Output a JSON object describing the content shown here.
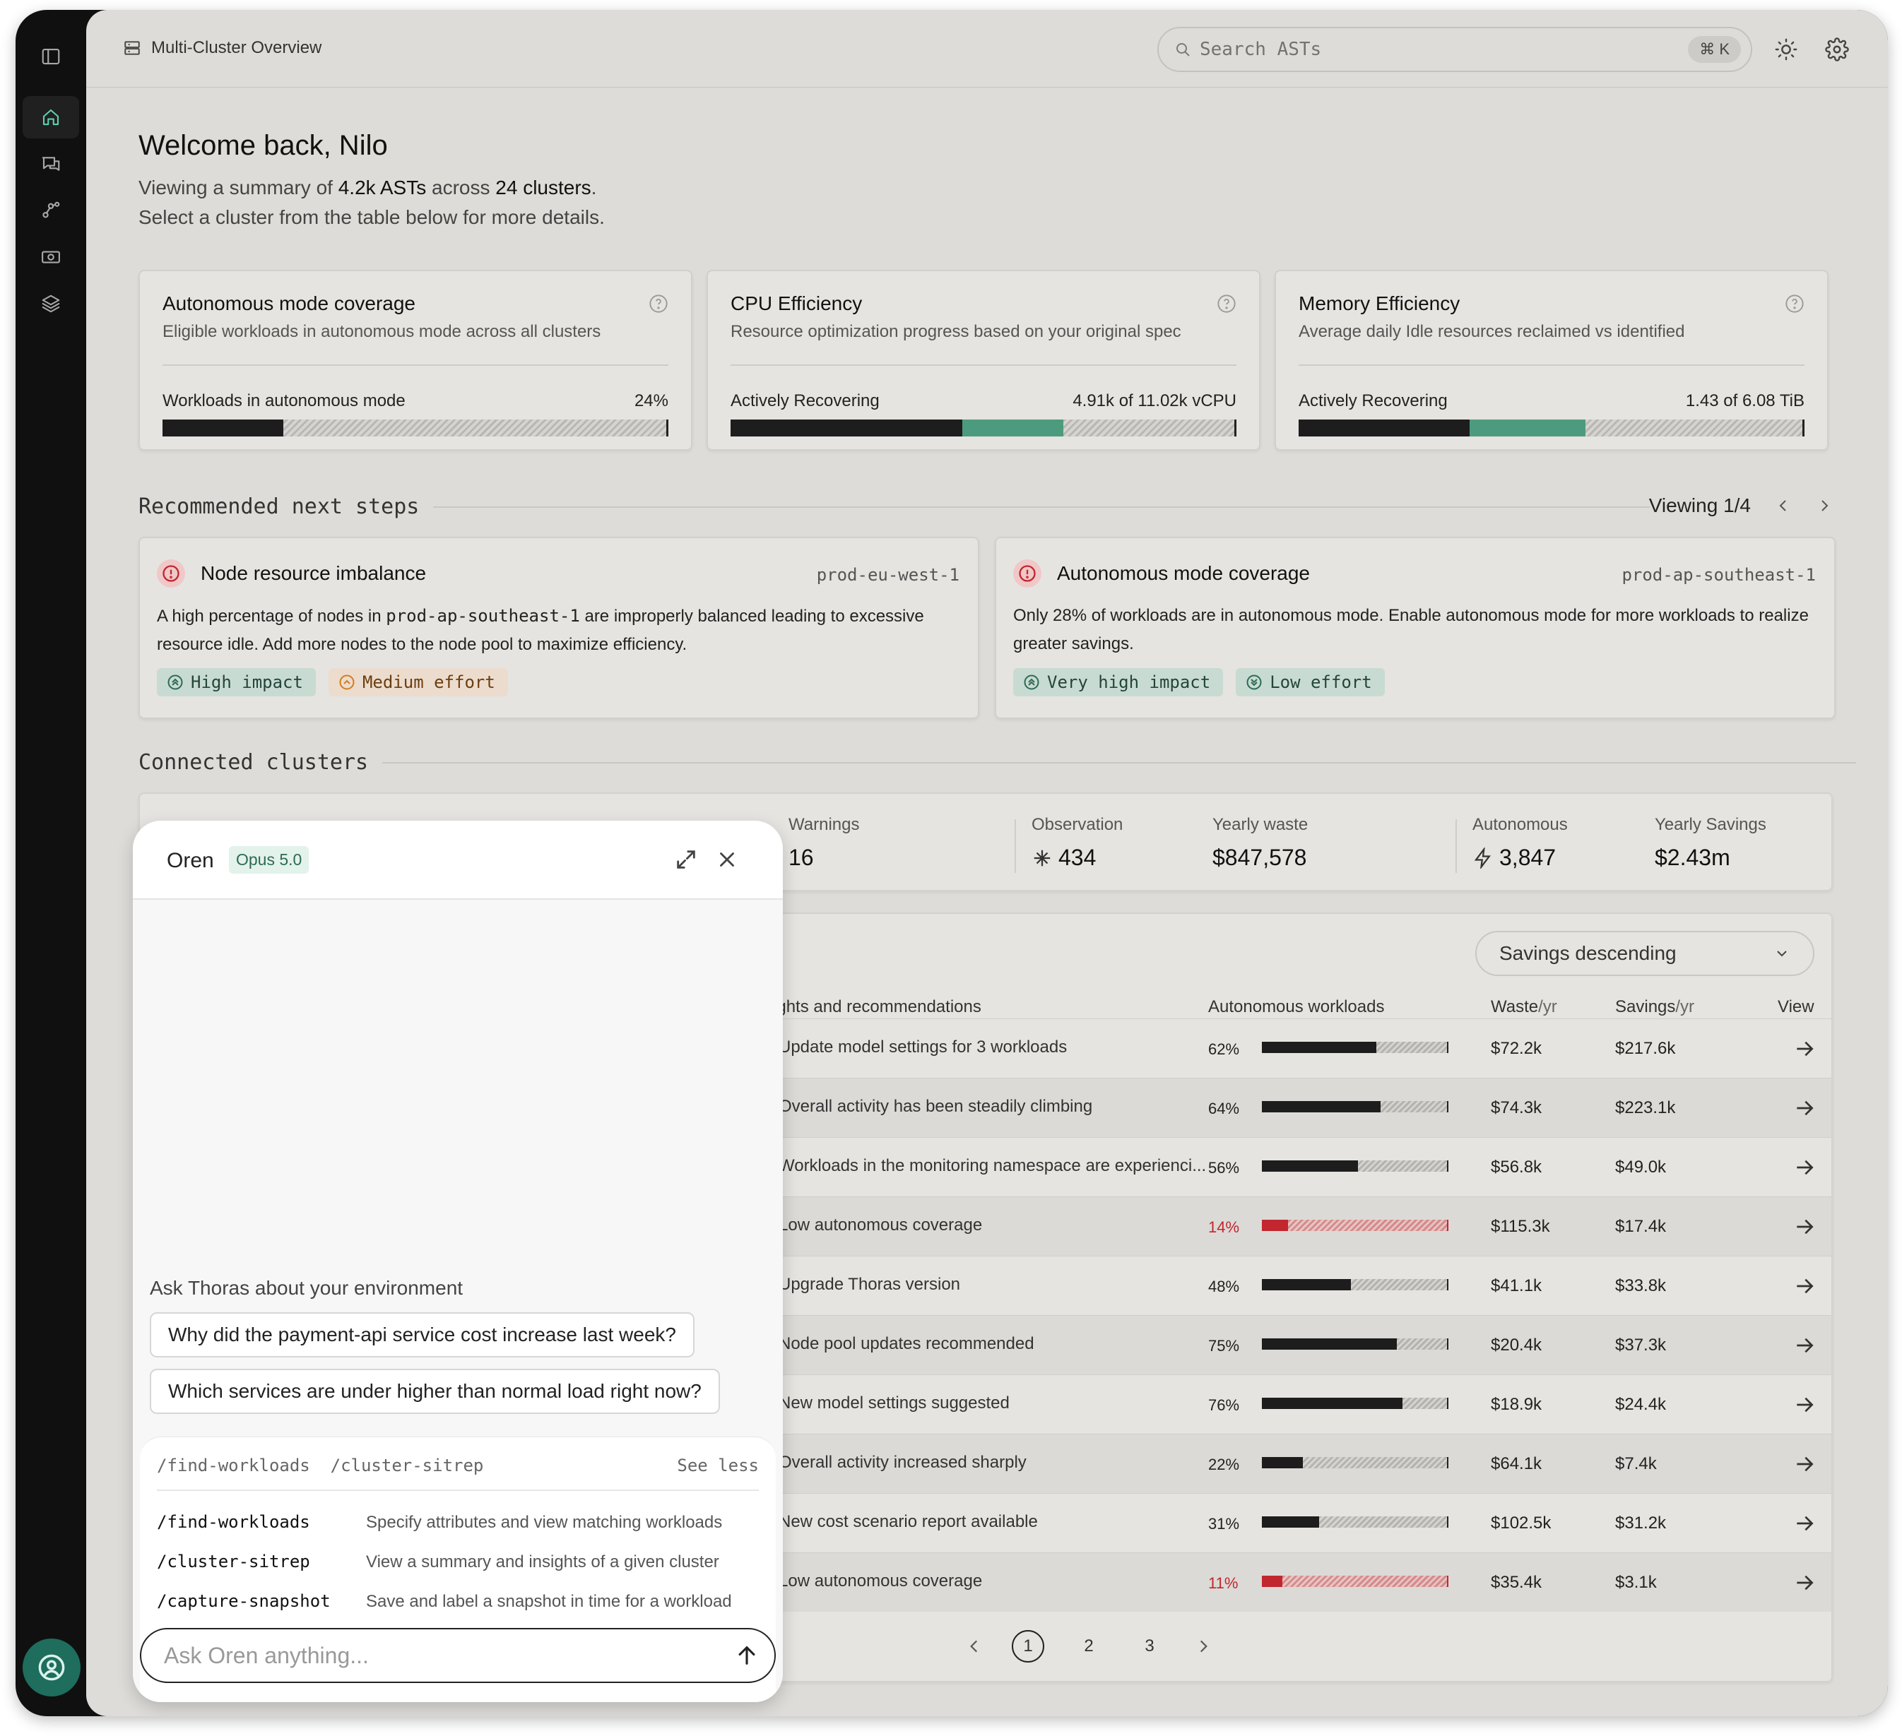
{
  "header": {
    "title": "Multi-Cluster Overview",
    "search_placeholder": "Search ASTs",
    "shortcut": "⌘ K"
  },
  "welcome": {
    "title": "Welcome back, Nilo",
    "line1_prefix": "Viewing a summary of",
    "asts": "4.2k ASTs",
    "line1_mid": "across",
    "clusters": "24 clusters",
    "line1_suffix": ".",
    "line2": "Select a cluster from the table below for more details."
  },
  "kpis": [
    {
      "title": "Autonomous mode coverage",
      "desc": "Eligible workloads in autonomous mode across all clusters",
      "label": "Workloads in autonomous mode",
      "value": "24%",
      "primary_fraction": 0.24,
      "secondary_fraction": 0
    },
    {
      "title": "CPU Efficiency",
      "desc": "Resource optimization progress based on your original spec",
      "label": "Actively Recovering",
      "value": "4.91k  of  11.02k vCPU",
      "primary_fraction": 0.46,
      "secondary_fraction": 0.2
    },
    {
      "title": "Memory Efficiency",
      "desc": "Average daily Idle resources reclaimed vs identified",
      "label": "Actively Recovering",
      "value": "1.43  of  6.08 TiB",
      "primary_fraction": 0.34,
      "secondary_fraction": 0.23
    }
  ],
  "recommended": {
    "heading": "Recommended next steps",
    "viewing": "Viewing 1/4",
    "cards": [
      {
        "title": "Node resource imbalance",
        "cluster": "prod-eu-west-1",
        "desc_pre": "A high percentage of nodes in",
        "desc_code": "prod-ap-southeast-1",
        "desc_post": "are improperly balanced leading to excessive resource idle. Add more nodes to the node pool to maximize efficiency.",
        "impact": "High impact",
        "effort": "Medium effort"
      },
      {
        "title": "Autonomous mode coverage",
        "cluster": "prod-ap-southeast-1",
        "desc": "Only 28% of workloads are in autonomous mode. Enable autonomous mode for more workloads to realize greater savings.",
        "impact": "Very high impact",
        "effort": "Low effort"
      }
    ]
  },
  "connected": {
    "heading": "Connected clusters"
  },
  "stats": [
    {
      "label": "Warnings",
      "value": "16"
    },
    {
      "label": "Observation",
      "value": "434"
    },
    {
      "label": "Yearly waste",
      "value": "$847,578"
    },
    {
      "label": "Autonomous",
      "value": "3,847"
    },
    {
      "label": "Yearly Savings",
      "value": "$2.43m"
    }
  ],
  "table": {
    "sort": "Savings descending",
    "columns": {
      "insights": "Insights and recommendations",
      "auto": "Autonomous workloads",
      "waste": "Waste",
      "waste_unit": "/yr",
      "savings": "Savings",
      "savings_unit": "/yr",
      "view": "View"
    },
    "rows": [
      {
        "insight": "Update model settings for 3 workloads",
        "pct": "62%",
        "frac": 0.62,
        "warn": false,
        "waste": "$72.2k",
        "savings": "$217.6k"
      },
      {
        "insight": "Overall activity has been steadily climbing",
        "pct": "64%",
        "frac": 0.64,
        "warn": false,
        "waste": "$74.3k",
        "savings": "$223.1k"
      },
      {
        "insight": "Workloads in the monitoring namespace are experienci...",
        "pct": "56%",
        "frac": 0.52,
        "warn": false,
        "waste": "$56.8k",
        "savings": "$49.0k"
      },
      {
        "insight": "Low autonomous coverage",
        "pct": "14%",
        "frac": 0.14,
        "warn": true,
        "waste": "$115.3k",
        "savings": "$17.4k"
      },
      {
        "insight": "Upgrade Thoras version",
        "pct": "48%",
        "frac": 0.48,
        "warn": false,
        "waste": "$41.1k",
        "savings": "$33.8k"
      },
      {
        "insight": "Node pool updates recommended",
        "pct": "75%",
        "frac": 0.73,
        "warn": false,
        "waste": "$20.4k",
        "savings": "$37.3k"
      },
      {
        "insight": "New model settings suggested",
        "pct": "76%",
        "frac": 0.76,
        "warn": false,
        "waste": "$18.9k",
        "savings": "$24.4k"
      },
      {
        "insight": "Overall activity increased sharply",
        "pct": "22%",
        "frac": 0.22,
        "warn": false,
        "waste": "$64.1k",
        "savings": "$7.4k"
      },
      {
        "insight": "New cost scenario report available",
        "pct": "31%",
        "frac": 0.31,
        "warn": false,
        "waste": "$102.5k",
        "savings": "$31.2k"
      },
      {
        "insight": "Low autonomous coverage",
        "pct": "11%",
        "frac": 0.11,
        "warn": true,
        "waste": "$35.4k",
        "savings": "$3.1k"
      }
    ],
    "pages": [
      "1",
      "2",
      "3"
    ],
    "current_page": "1"
  },
  "chat": {
    "name": "Oren",
    "model": "Opus 5.0",
    "prompt": "Ask Thoras about your environment",
    "suggestions": [
      "Why did the payment-api service cost increase last week?",
      "Which services are under higher than normal load right now?"
    ],
    "cmd_header": "/find-workloads  /cluster-sitrep",
    "see_less": "See less",
    "commands": [
      {
        "name": "/find-workloads",
        "desc": "Specify attributes and view matching workloads"
      },
      {
        "name": "/cluster-sitrep",
        "desc": "View a summary and insights of a given cluster"
      },
      {
        "name": "/capture-snapshot",
        "desc": "Save and label a snapshot in time for a workload"
      }
    ],
    "input_placeholder": "Ask Oren anything..."
  },
  "colors": {
    "accent": "#4d9b7f",
    "danger": "#c2262e",
    "rail": "#101010",
    "surface": "#dedcd8"
  }
}
